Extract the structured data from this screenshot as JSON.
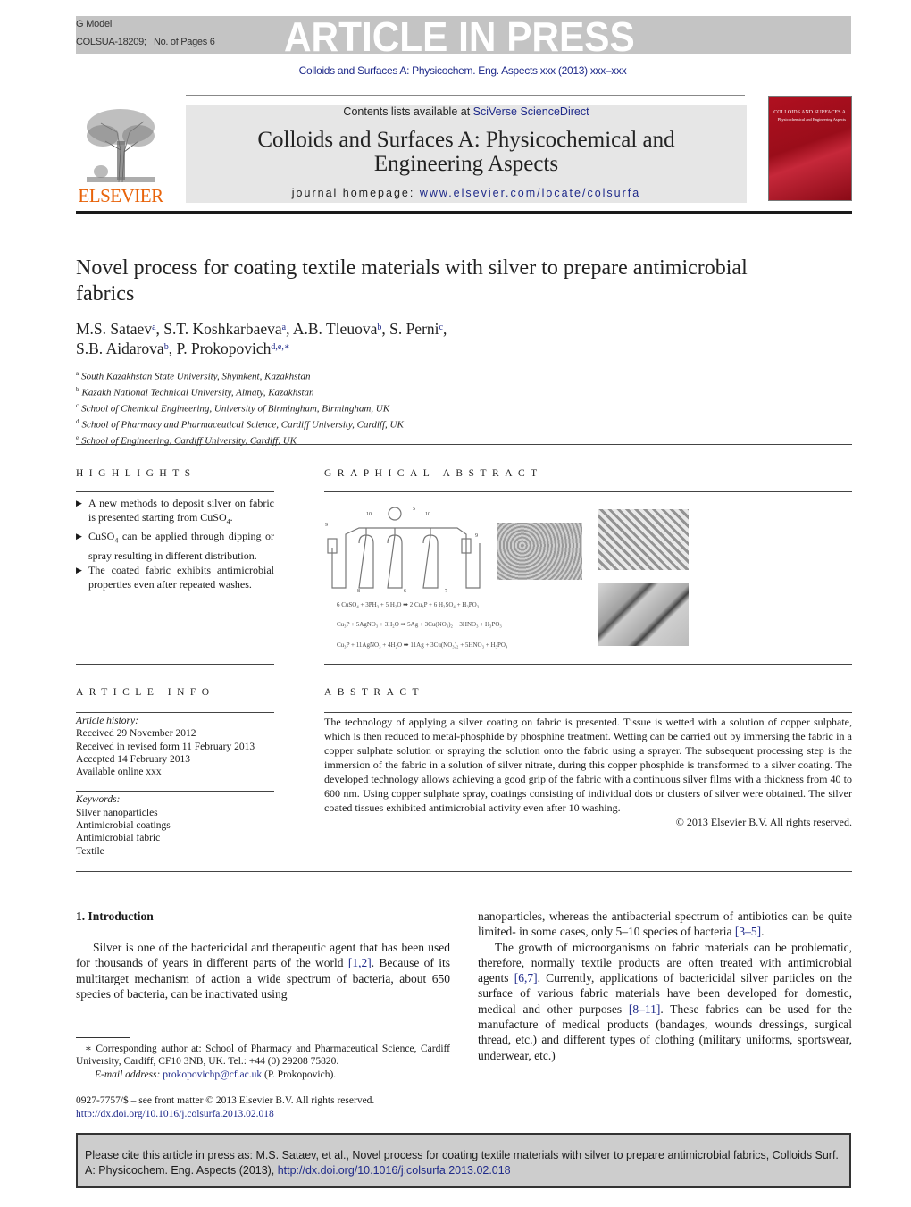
{
  "banner": {
    "g_model": "G Model",
    "manuscript_id": "COLSUA-18209;",
    "pages": "No. of Pages 6",
    "article_in_press": "ARTICLE IN PRESS"
  },
  "journal_ref": "Colloids and Surfaces A: Physicochem. Eng. Aspects xxx (2013) xxx–xxx",
  "header": {
    "publisher_logo_text": "ELSEVIER",
    "contents_prefix": "Contents lists available at ",
    "contents_link": "SciVerse ScienceDirect",
    "journal_title_line1": "Colloids and Surfaces A: Physicochemical and",
    "journal_title_line2": "Engineering Aspects",
    "homepage_prefix": "journal homepage: ",
    "homepage_link": "www.elsevier.com/locate/colsurfa",
    "cover_title": "COLLOIDS AND SURFACES A",
    "cover_subtitle": "Physicochemical and Engineering Aspects"
  },
  "article": {
    "title": "Novel process for coating textile materials with silver to prepare antimicrobial fabrics",
    "authors": [
      {
        "name": "M.S. Sataev",
        "aff": "a",
        "sep": ", "
      },
      {
        "name": "S.T. Koshkarbaeva",
        "aff": "a",
        "sep": ", "
      },
      {
        "name": "A.B. Tleuova",
        "aff": "b",
        "sep": ", "
      },
      {
        "name": "S. Perni",
        "aff": "c",
        "sep": ","
      },
      {
        "name": "S.B. Aidarova",
        "aff": "b",
        "sep": ", "
      },
      {
        "name": "P. Prokopovich",
        "aff": "d,e,∗",
        "sep": ""
      }
    ],
    "affiliations": [
      {
        "key": "a",
        "text": "South Kazakhstan State University, Shymkent, Kazakhstan"
      },
      {
        "key": "b",
        "text": "Kazakh National Technical University, Almaty, Kazakhstan"
      },
      {
        "key": "c",
        "text": "School of Chemical Engineering, University of Birmingham, Birmingham, UK"
      },
      {
        "key": "d",
        "text": "School of Pharmacy and Pharmaceutical Science, Cardiff University, Cardiff, UK"
      },
      {
        "key": "e",
        "text": "School of Engineering, Cardiff University, Cardiff, UK"
      }
    ]
  },
  "highlights": {
    "label": "HIGHLIGHTS",
    "items": [
      {
        "pre": "A new methods to deposit silver on fabric is presented starting from CuSO",
        "sub": "4",
        "post": "."
      },
      {
        "pre": "CuSO",
        "sub": "4",
        "post": " can be applied through dipping or spray resulting in different distribution."
      },
      {
        "pre": "The coated fabric exhibits antimicrobial properties even after repeated washes.",
        "sub": "",
        "post": ""
      }
    ]
  },
  "graphical_abstract": {
    "label": "GRAPHICAL ABSTRACT",
    "apparatus_labels": [
      "9",
      "10",
      "5",
      "10",
      "9",
      "8",
      "6",
      "7"
    ],
    "equations": [
      "6 CuSO₄ + 3PH₃ + 5 H₂O  ➡  2 Cu₃P + 6 H₂SO₄ + H₃PO₃",
      "Cu₃P + 5AgNO₃ + 3H₂O  ➡  5Ag + 3Cu(NO₃)₂ + 3HNO₃ + H₃PO₃",
      "Cu₃P + 11AgNO₃ + 4H₂O  ➡  11Ag + 3Cu(NO₃)₂ + 5HNO₃ + H₃PO₄"
    ]
  },
  "article_info": {
    "label": "ARTICLE INFO",
    "history_label": "Article history:",
    "history": [
      "Received 29 November 2012",
      "Received in revised form 11 February 2013",
      "Accepted 14 February 2013",
      "Available online xxx"
    ],
    "keywords_label": "Keywords:",
    "keywords": [
      "Silver nanoparticles",
      "Antimicrobial coatings",
      "Antimicrobial fabric",
      "Textile"
    ]
  },
  "abstract": {
    "label": "ABSTRACT",
    "text": "The technology of applying a silver coating on fabric is presented. Tissue is wetted with a solution of copper sulphate, which is then reduced to metal-phosphide by phosphine treatment. Wetting can be carried out by immersing the fabric in a copper sulphate solution or spraying the solution onto the fabric using a sprayer. The subsequent processing step is the immersion of the fabric in a solution of silver nitrate, during this copper phosphide is transformed to a silver coating. The developed technology allows achieving a good grip of the fabric with a continuous silver films with a thickness from 40 to 600 nm. Using copper sulphate spray, coatings consisting of individual dots or clusters of silver were obtained. The silver coated tissues exhibited antimicrobial activity even after 10 washing.",
    "copyright": "© 2013 Elsevier B.V. All rights reserved."
  },
  "introduction": {
    "heading": "1.  Introduction",
    "p1_a": "Silver is one of the bactericidal and therapeutic agent that has been used for thousands of years in different parts of the world ",
    "p1_ref1": "[1,2]",
    "p1_b": ". Because of its multitarget mechanism of action a wide spectrum of bacteria, about 650 species of bacteria, can be inactivated using nanoparticles, whereas the antibacterial spectrum of antibiotics can be quite limited- in some cases, only 5–10 species of bacteria ",
    "p1_ref2": "[3–5]",
    "p1_c": ".",
    "p2_a": "The growth of microorganisms on fabric materials can be problematic, therefore, normally textile products are often treated with antimicrobial agents ",
    "p2_ref1": "[6,7]",
    "p2_b": ". Currently, applications of bactericidal silver particles on the surface of various fabric materials have been developed for domestic, medical and other purposes ",
    "p2_ref2": "[8–11]",
    "p2_c": ". These fabrics can be used for the manufacture of medical products (bandages, wounds dressings, surgical thread, etc.) and different types of clothing (military uniforms, sportswear, underwear, etc.)",
    "left_col_text": "Silver is one of the bactericidal and therapeutic agent that has been used for thousands of years in different parts of the world",
    "left_col_ref": "[1,2]",
    "left_col_rest": ". Because of its multitarget mechanism of action a wide spectrum of bacteria, about 650 species of bacteria, can be inactivated using",
    "right_col_p1": "nanoparticles, whereas the antibacterial spectrum of antibiotics can be quite limited- in some cases, only 5–10 species of bacteria ",
    "right_col_p1_ref": "[3–5]",
    "right_col_p1_end": "."
  },
  "footnote": {
    "corresponding": "∗ Corresponding author at: School of Pharmacy and Pharmaceutical Science, Cardiff University, Cardiff, CF10 3NB, UK. Tel.: +44 (0) 29208 75820.",
    "email_label": "E-mail address: ",
    "email": "prokopovichp@cf.ac.uk",
    "email_owner": " (P. Prokopovich).",
    "issn": "0927-7757/$ – see front matter © 2013 Elsevier B.V. All rights reserved.",
    "doi": "http://dx.doi.org/10.1016/j.colsurfa.2013.02.018"
  },
  "cite_box": {
    "text": "Please cite this article in press as: M.S. Sataev, et al., Novel process for coating textile materials with silver to prepare antimicrobial fabrics, Colloids Surf. A: Physicochem. Eng. Aspects (2013), ",
    "doi_link": "http://dx.doi.org/10.1016/j.colsurfa.2013.02.018"
  }
}
